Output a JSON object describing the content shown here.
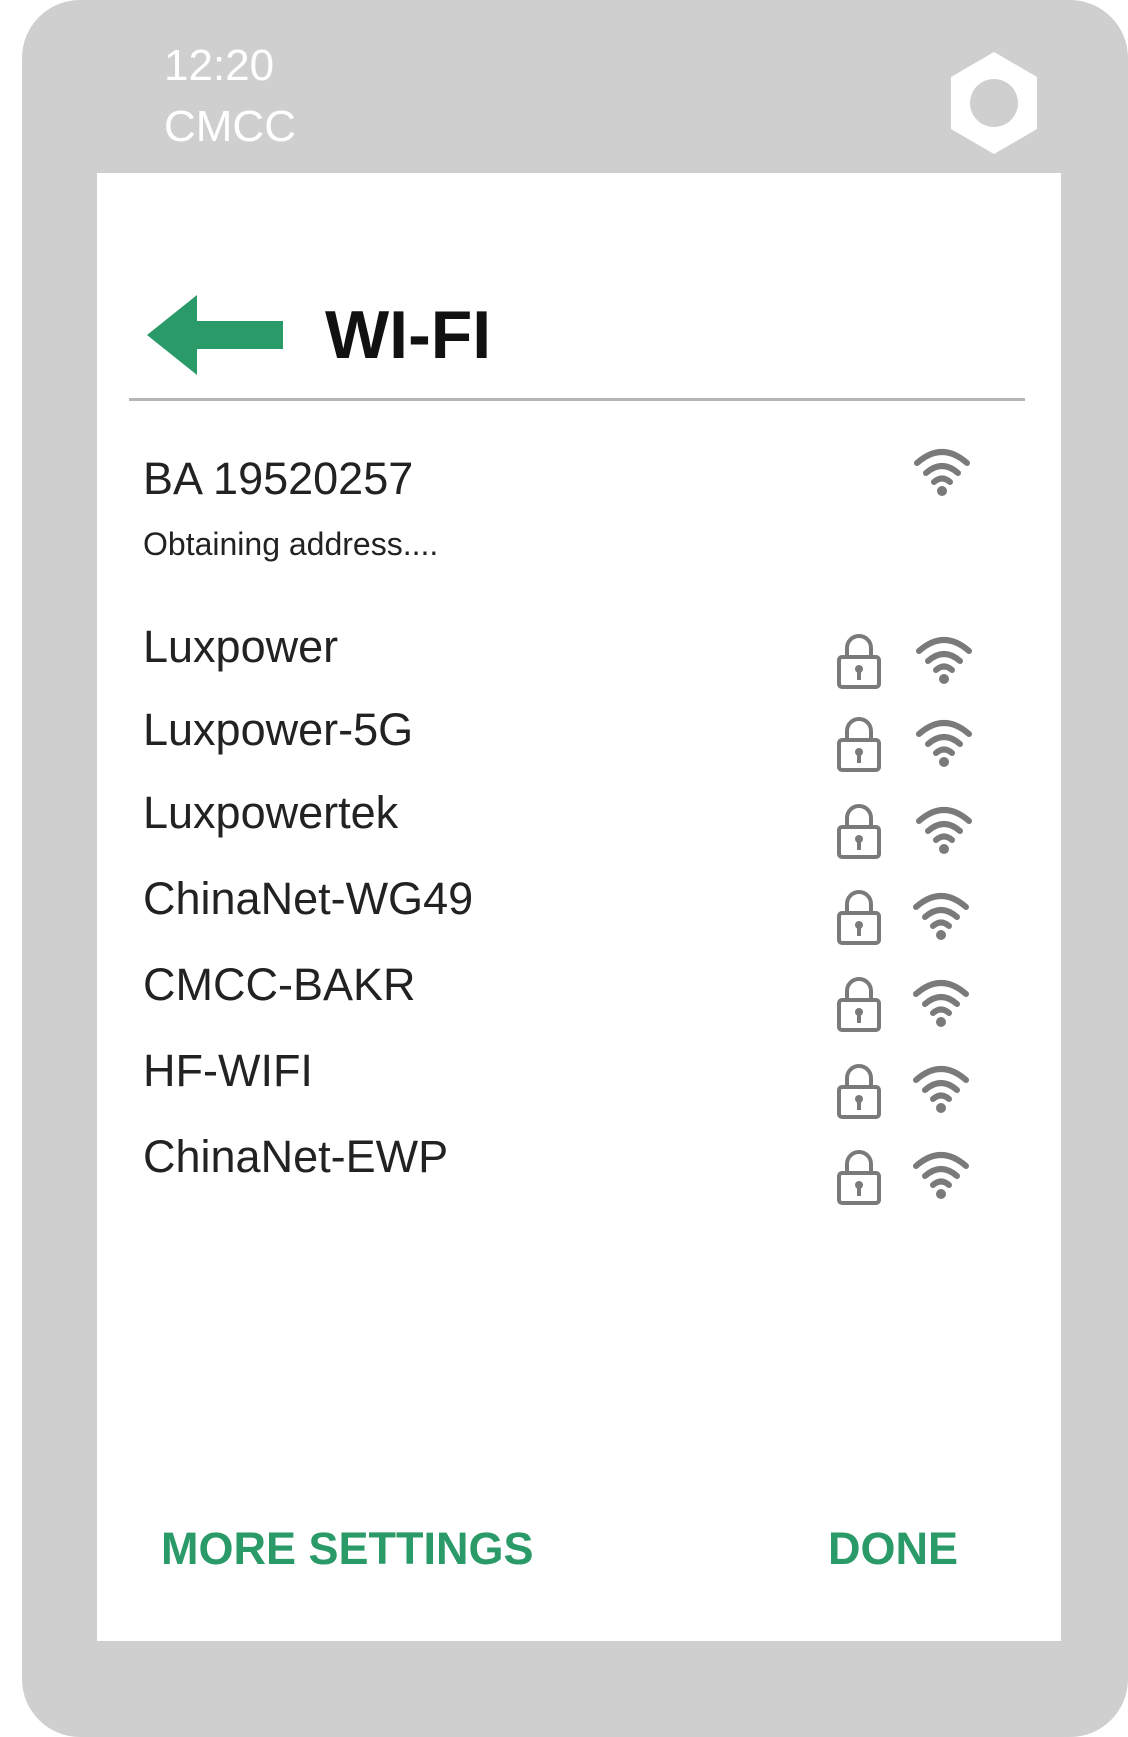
{
  "status_bar": {
    "time": "12:20",
    "carrier": "CMCC",
    "home_icon": "hexagon-icon"
  },
  "header": {
    "title": "WI-FI",
    "back_icon": "arrow-left-icon"
  },
  "connected_network": {
    "name": "BA 19520257",
    "status": "Obtaining address....",
    "secured": false
  },
  "networks": [
    {
      "name": "Luxpower",
      "secured": true
    },
    {
      "name": "Luxpower-5G",
      "secured": true
    },
    {
      "name": "Luxpowertek",
      "secured": true
    },
    {
      "name": "ChinaNet-WG49",
      "secured": true
    },
    {
      "name": "CMCC-BAKR",
      "secured": true
    },
    {
      "name": "HF-WIFI",
      "secured": true
    },
    {
      "name": "ChinaNet-EWP",
      "secured": true
    }
  ],
  "actions": {
    "more_settings": "MORE SETTINGS",
    "done": "DONE"
  },
  "colors": {
    "accent": "#2a9a68",
    "frame": "#cfcfcf",
    "icon_gray": "#7a7a7a"
  }
}
